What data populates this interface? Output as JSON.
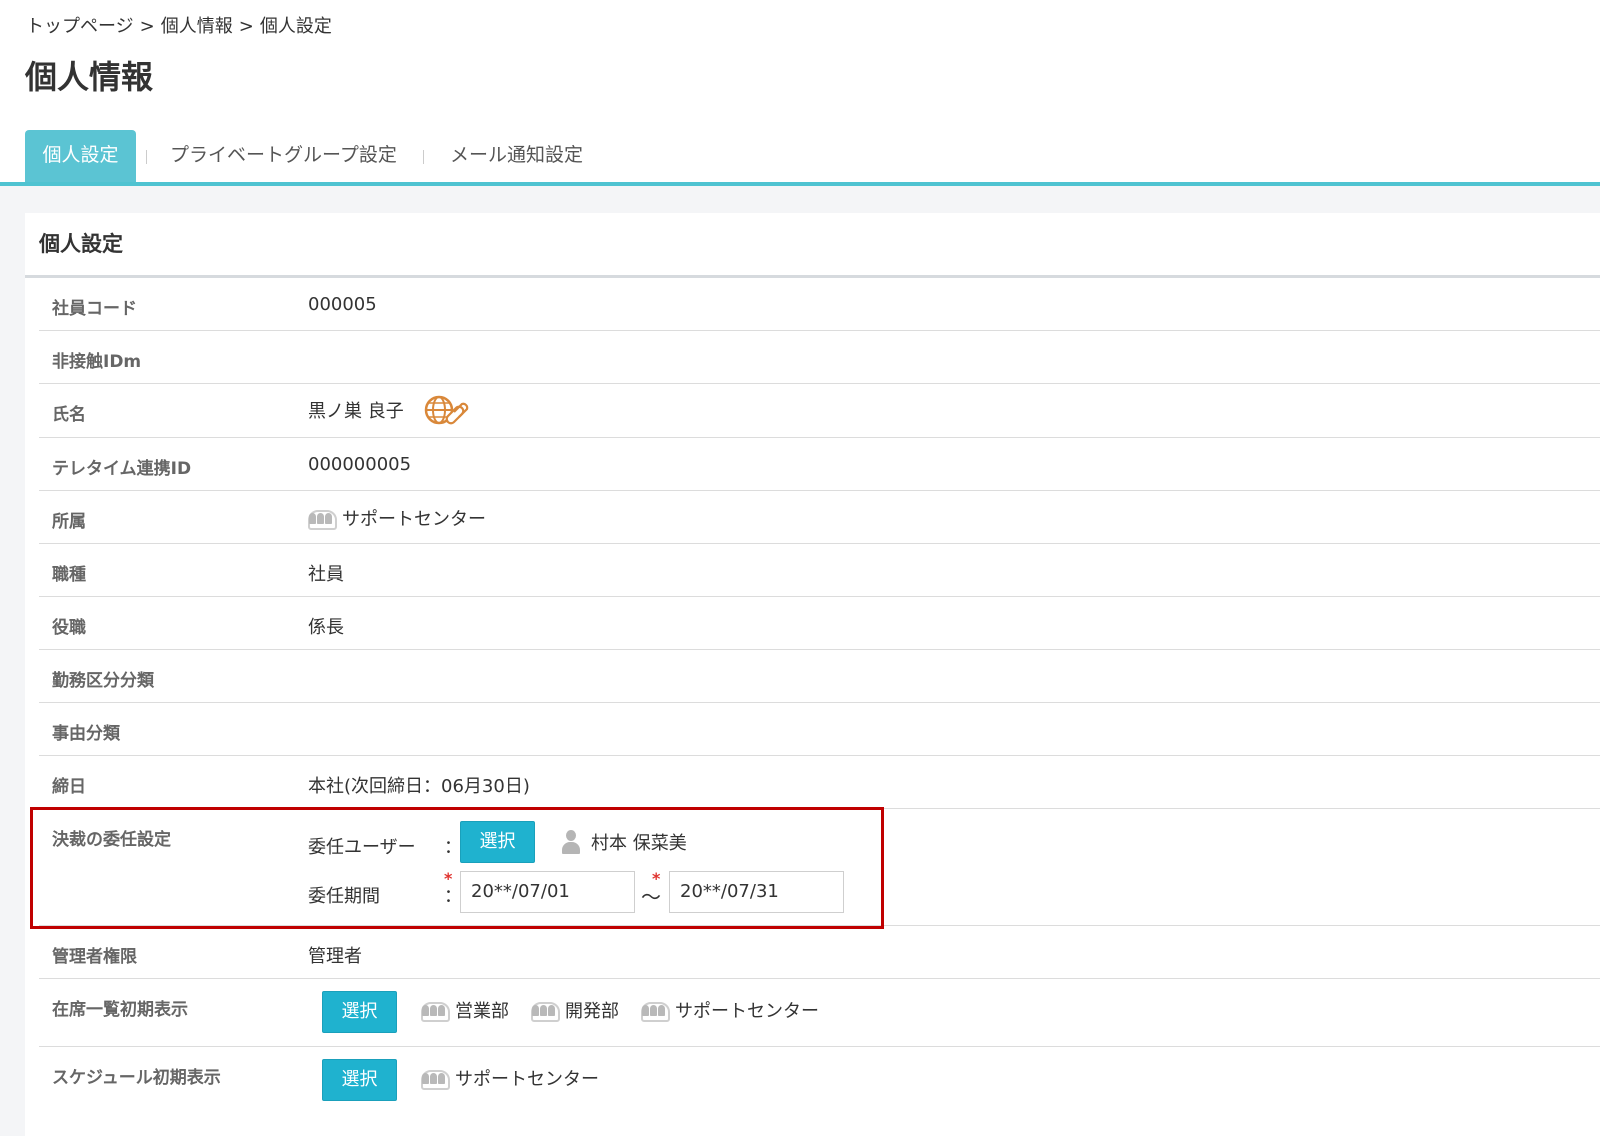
{
  "breadcrumb": [
    "トップページ",
    "個人情報",
    "個人設定"
  ],
  "breadcrumb_separator": ">",
  "page_title": "個人情報",
  "tabs": [
    "個人設定",
    "プライベートグループ設定",
    "メール通知設定"
  ],
  "tab_separator": "|",
  "panel_title": "個人設定",
  "fields": {
    "employee_code": {
      "label": "社員コード",
      "value": "000005"
    },
    "idm": {
      "label": "非接触IDm",
      "value": ""
    },
    "name": {
      "label": "氏名",
      "value": "黒ノ巣 良子"
    },
    "teletime_id": {
      "label": "テレタイム連携ID",
      "value": "000000005"
    },
    "department": {
      "label": "所属",
      "value": "サポートセンター"
    },
    "job_type": {
      "label": "職種",
      "value": "社員"
    },
    "position": {
      "label": "役職",
      "value": "係長"
    },
    "work_category": {
      "label": "勤務区分分類",
      "value": ""
    },
    "reason_category": {
      "label": "事由分類",
      "value": ""
    },
    "closing_day": {
      "label": "締日",
      "value": "本社(次回締日：06月30日)"
    },
    "delegation": {
      "label": "決裁の委任設定",
      "user_label": "委任ユーザー",
      "period_label": "委任期間",
      "colon": "：",
      "select_label": "選択",
      "delegate_user": "村本 保菜美",
      "required_mark": "*",
      "date_from": "20**/07/01",
      "date_to": "20**/07/31",
      "tilde": "～"
    },
    "admin": {
      "label": "管理者権限",
      "value": "管理者"
    },
    "presence_default": {
      "label": "在席一覧初期表示",
      "select_label": "選択",
      "groups": [
        "営業部",
        "開発部",
        "サポートセンター"
      ]
    },
    "schedule_default": {
      "label": "スケジュール初期表示",
      "select_label": "選択",
      "groups": [
        "サポートセンター"
      ]
    }
  },
  "colors": {
    "accent": "#4fc3d1",
    "button": "#1fb2cf",
    "highlight": "#c00000",
    "required": "#e0332f"
  }
}
